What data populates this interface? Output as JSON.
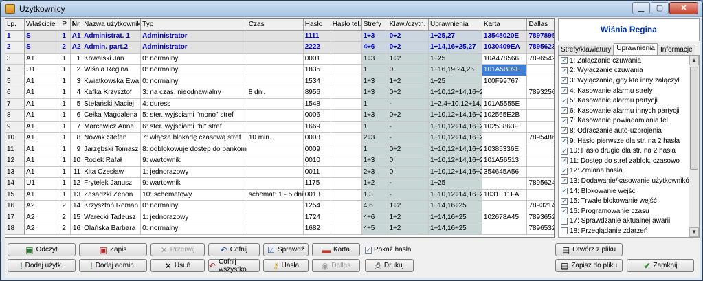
{
  "window": {
    "title": "Użytkownicy"
  },
  "grid": {
    "headers": [
      "Lp.",
      "Właściciel",
      "P",
      "Nr",
      "Nazwa użytkownika",
      "Typ",
      "Czas",
      "Hasło",
      "Hasło tel.",
      "Strefy",
      "Klaw./czytn.",
      "Uprawnienia",
      "Karta",
      "Dallas"
    ],
    "rows": [
      [
        "1",
        "S",
        "1",
        "A1",
        "Administrat. 1",
        "Administrator",
        "",
        "1111",
        "",
        "1÷3",
        "0÷2",
        "1÷25,27",
        "13548020E",
        "789789563"
      ],
      [
        "2",
        "S",
        "2",
        "A2",
        "Admin. part.2",
        "Administrator",
        "",
        "2222",
        "",
        "4÷6",
        "0÷2",
        "1÷14,16÷25,27",
        "1030409EA",
        "789562365"
      ],
      [
        "3",
        "A1",
        "1",
        "1",
        "Kowalski Jan",
        "0: normalny",
        "",
        "0001",
        "",
        "1÷3",
        "1÷2",
        "1÷25",
        "10A478566",
        "789654235"
      ],
      [
        "4",
        "U1",
        "1",
        "2",
        "Wiśnia Regina",
        "0: normalny",
        "",
        "1835",
        "",
        "1",
        "0",
        "1÷16,19,24,26",
        "101A5B09E",
        ""
      ],
      [
        "5",
        "A1",
        "1",
        "3",
        "Kwiatkowska Ewa",
        "0: normalny",
        "",
        "1534",
        "",
        "1÷3",
        "1÷2",
        "1÷25",
        "100F99767",
        ""
      ],
      [
        "6",
        "A1",
        "1",
        "4",
        "Kafka Krzysztof",
        "3: na czas, nieodnawialny",
        "8 dni.",
        "8956",
        "",
        "1÷3",
        "0÷2",
        "1÷10,12÷14,16÷25",
        "",
        "789325615"
      ],
      [
        "7",
        "A1",
        "1",
        "5",
        "Stefański Maciej",
        "4: duress",
        "",
        "1548",
        "",
        "1",
        "-",
        "1÷2,4÷10,12÷14,16",
        "101A5555E",
        ""
      ],
      [
        "8",
        "A1",
        "1",
        "6",
        "Cełka Magdalena",
        "5: ster. wyjściami \"mono\" stref",
        "",
        "0006",
        "",
        "1÷3",
        "0÷2",
        "1÷10,12÷14,16÷25",
        "102565E2B",
        ""
      ],
      [
        "9",
        "A1",
        "1",
        "7",
        "Marcewicz Anna",
        "6: ster. wyjściami \"bi\" stref",
        "",
        "1669",
        "",
        "1",
        "-",
        "1÷10,12÷14,16÷25",
        "10253863F",
        ""
      ],
      [
        "10",
        "A1",
        "1",
        "8",
        "Nowak Stefan",
        "7: włącza blokadę czasową stref",
        "10 min.",
        "0008",
        "",
        "2÷3",
        "-",
        "1÷10,12÷14,16÷25",
        "",
        "789548692"
      ],
      [
        "11",
        "A1",
        "1",
        "9",
        "Jarzębski Tomasz",
        "8: odblokowuje dostęp do bankomatu",
        "",
        "0009",
        "",
        "1",
        "0÷2",
        "1÷10,12÷14,16÷25",
        "10385336E",
        ""
      ],
      [
        "12",
        "A1",
        "1",
        "10",
        "Rodek Rafał",
        "9: wartownik",
        "",
        "0010",
        "",
        "1÷3",
        "0",
        "1÷10,12÷14,16÷25",
        "101A56513",
        ""
      ],
      [
        "13",
        "A1",
        "1",
        "11",
        "Kita Czesław",
        "1: jednorazowy",
        "",
        "0011",
        "",
        "2÷3",
        "0",
        "1÷10,12÷14,16÷25",
        "354645A56",
        ""
      ],
      [
        "14",
        "U1",
        "1",
        "12",
        "Frytelek Janusz",
        "9: wartownik",
        "",
        "1175",
        "",
        "1÷2",
        "-",
        "1÷25",
        "",
        "789562456"
      ],
      [
        "15",
        "A1",
        "1",
        "13",
        "Zasadzki Zenon",
        "10: schematowy",
        "schemat: 1 - 5 dni.",
        "0013",
        "",
        "1,3",
        "-",
        "1÷10,12÷14,16÷25",
        "1031E11FA",
        ""
      ],
      [
        "16",
        "A2",
        "2",
        "14",
        "Krzysztoń Roman",
        "0: normalny",
        "",
        "1254",
        "",
        "4,6",
        "1÷2",
        "1÷14,16÷25",
        "",
        "789321456"
      ],
      [
        "17",
        "A2",
        "2",
        "15",
        "Warecki Tadeusz",
        "1: jednorazowy",
        "",
        "1724",
        "",
        "4÷6",
        "1÷2",
        "1÷14,16÷25",
        "102678A45",
        "789365214"
      ],
      [
        "18",
        "A2",
        "2",
        "16",
        "Olańska Barbara",
        "0: normalny",
        "",
        "1682",
        "",
        "4÷5",
        "1÷2",
        "1÷14,16÷25",
        "",
        "789653258"
      ]
    ]
  },
  "panel": {
    "user_name": "Wiśnia Regina",
    "tabs": [
      "Strefy/klawiatury",
      "Uprawnienia",
      "Informacje"
    ],
    "permissions": [
      {
        "label": "1: Załączanie czuwania",
        "checked": true
      },
      {
        "label": "2: Wyłączanie czuwania",
        "checked": true
      },
      {
        "label": "3: Wyłączanie, gdy kto inny załączył",
        "checked": true
      },
      {
        "label": "4: Kasowanie alarmu strefy",
        "checked": true
      },
      {
        "label": "5: Kasowanie alarmu partycji",
        "checked": true
      },
      {
        "label": "6: Kasowanie alarmu innych partycji",
        "checked": true
      },
      {
        "label": "7: Kasowanie powiadamiania tel.",
        "checked": true
      },
      {
        "label": "8: Odraczanie auto-uzbrojenia",
        "checked": true
      },
      {
        "label": "9: Hasło pierwsze dla str. na 2 hasła",
        "checked": true
      },
      {
        "label": "10: Hasło drugie dla str. na 2 hasła",
        "checked": true
      },
      {
        "label": "11: Dostęp do stref zablok. czasowo",
        "checked": true
      },
      {
        "label": "12: Zmiana hasła",
        "checked": true
      },
      {
        "label": "13: Dodawanie/kasowanie użytkowników",
        "checked": true
      },
      {
        "label": "14: Blokowanie wejść",
        "checked": true
      },
      {
        "label": "15: Trwałe blokowanie wejść",
        "checked": true
      },
      {
        "label": "16: Programowanie czasu",
        "checked": true
      },
      {
        "label": "17: Sprawdzanie aktualnej awarii",
        "checked": false
      },
      {
        "label": "18: Przeglądanie zdarzeń",
        "checked": false
      },
      {
        "label": "19: Resetowanie czujników",
        "checked": true
      }
    ]
  },
  "buttons": {
    "odczyt": "Odczyt",
    "zapis": "Zapis",
    "przerwij": "Przerwij",
    "cofnij": "Cofnij",
    "sprawdz": "Sprawdź",
    "karta": "Karta",
    "pokaz_hasla": "Pokaż hasła",
    "dodaj_uzytk": "Dodaj użytk.",
    "dodaj_admin": "Dodaj admin.",
    "usun": "Usuń",
    "cofnij_wszystko": "Cofnij wszystko",
    "hasla": "Hasła",
    "dallas": "Dallas",
    "drukuj": "Drukuj",
    "otworz": "Otwórz z pliku",
    "zapisz_plik": "Zapisz do pliku",
    "zamknij": "Zamknij"
  },
  "icons": {
    "check_mark": "✓"
  }
}
